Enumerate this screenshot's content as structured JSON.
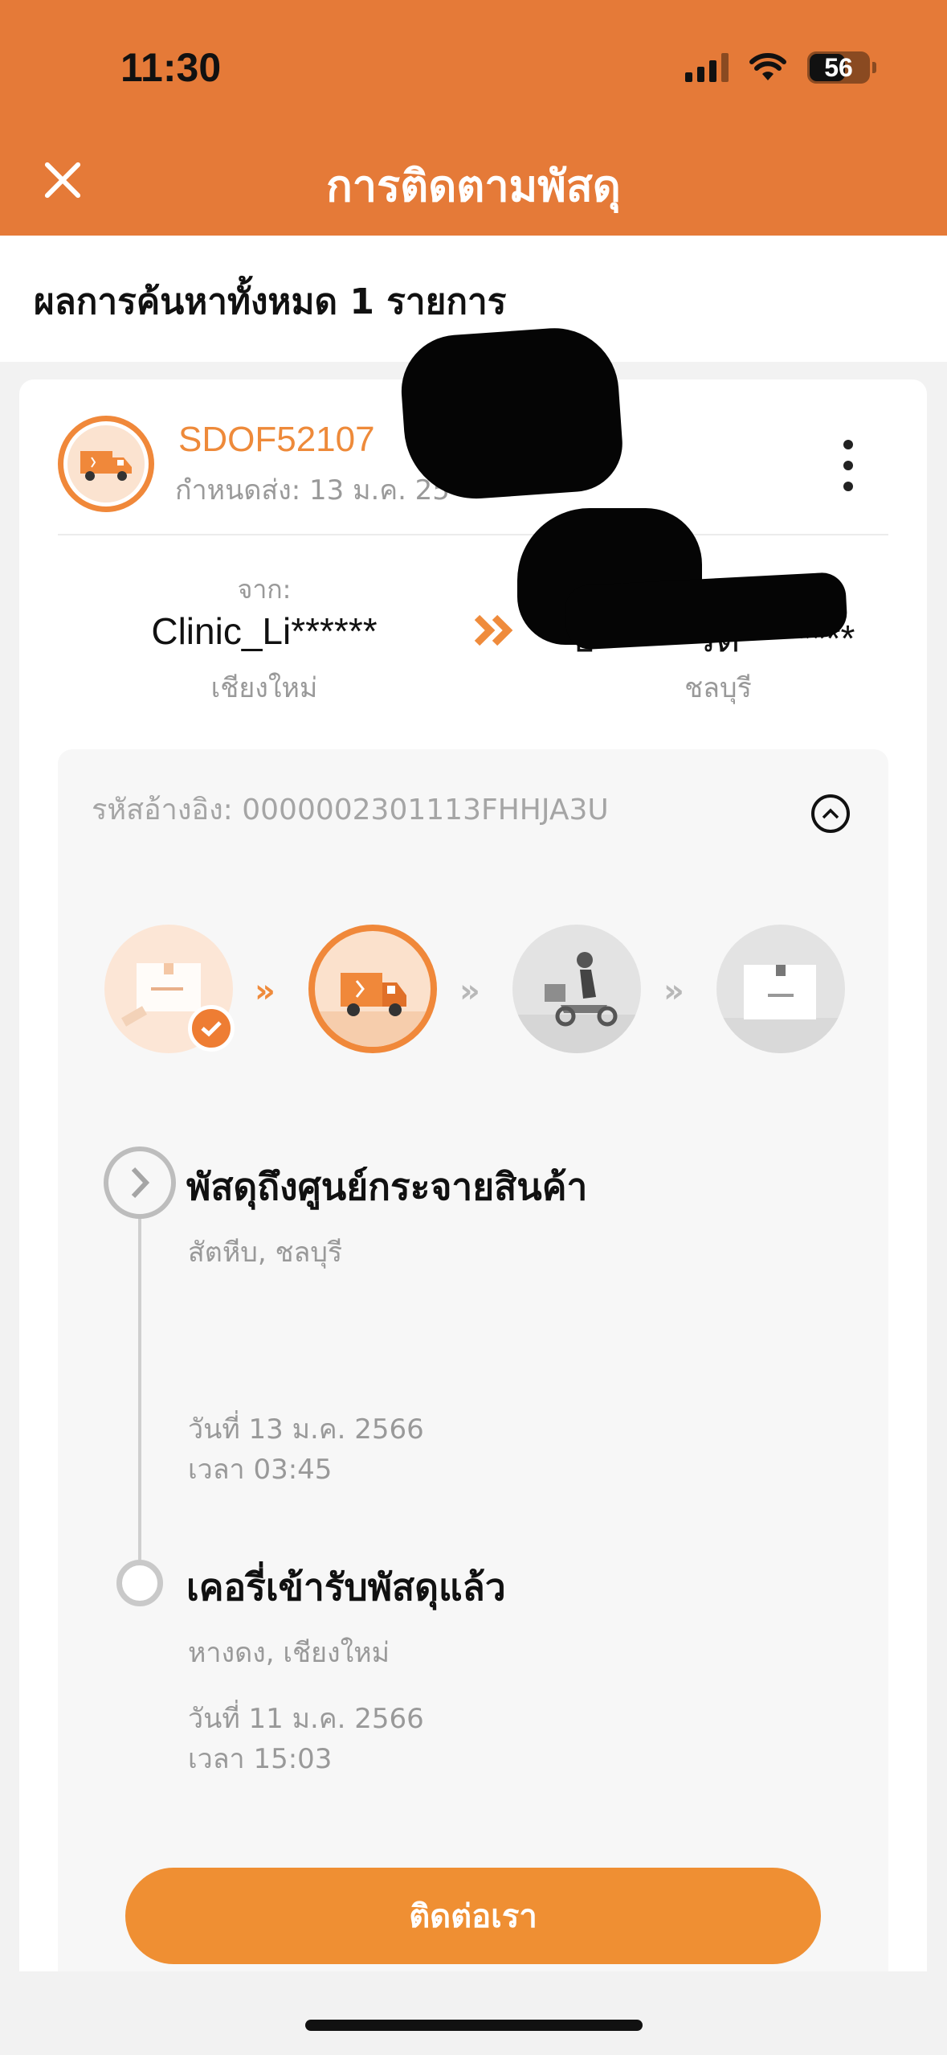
{
  "status_bar": {
    "time": "11:30",
    "battery": "56"
  },
  "header": {
    "title": "การติดตามพัสดุ"
  },
  "results": {
    "summary": "ผลการค้นหาทั้งหมด 1 รายการ"
  },
  "shipment": {
    "tracking_number": "SDOF52107",
    "due_date": "กำหนดส่ง: 13 ม.ค. 25",
    "from_label": "จาก:",
    "from_name": "Clinic_Li******",
    "from_province": "เชียงใหม่",
    "to_name": "อ*******รัต********",
    "to_province": "ชลบุรี",
    "reference": "รหัสอ้างอิง: 0000002301113FHHJA3U"
  },
  "steps": [
    {
      "icon": "package-box-icon",
      "state": "done"
    },
    {
      "icon": "delivery-truck-icon",
      "state": "current"
    },
    {
      "icon": "courier-scooter-icon",
      "state": "pending"
    },
    {
      "icon": "delivered-box-icon",
      "state": "pending"
    }
  ],
  "timeline": [
    {
      "title": "พัสดุถึงศูนย์กระจายสินค้า",
      "location": "สัตหีบ, ชลบุรี",
      "date": "วันที่ 13 ม.ค. 2566",
      "time": "เวลา 03:45"
    },
    {
      "title": "เคอรี่เข้ารับพัสดุแล้ว",
      "location": "หางดง, เชียงใหม่",
      "date": "วันที่ 11 ม.ค. 2566",
      "time": "เวลา 15:03"
    }
  ],
  "actions": {
    "contact": "ติดต่อเรา"
  },
  "colors": {
    "brand": "#e57a38",
    "accent": "#ef8f33",
    "muted": "#999999"
  }
}
